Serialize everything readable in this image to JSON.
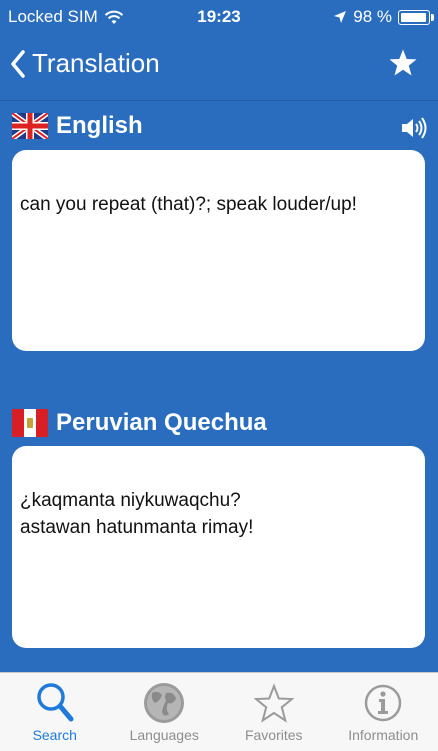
{
  "status": {
    "carrier": "Locked SIM",
    "time": "19:23",
    "battery_text": "98 %",
    "battery_level": 0.98
  },
  "nav": {
    "back_label": "Translation"
  },
  "source": {
    "language": "English",
    "text": "can you repeat (that)?; speak louder/up!"
  },
  "target": {
    "language": "Peruvian Quechua",
    "text": "¿kaqmanta niykuwaqchu?\nastawan hatunmanta rimay!"
  },
  "tabs": [
    {
      "label": "Search",
      "icon": "search-icon",
      "active": true
    },
    {
      "label": "Languages",
      "icon": "globe-icon",
      "active": false
    },
    {
      "label": "Favorites",
      "icon": "star-icon",
      "active": false
    },
    {
      "label": "Information",
      "icon": "info-icon",
      "active": false
    }
  ],
  "colors": {
    "background": "#2a6dbf",
    "active_tab": "#1e7bd9",
    "inactive_tab": "#8e8e8e"
  }
}
